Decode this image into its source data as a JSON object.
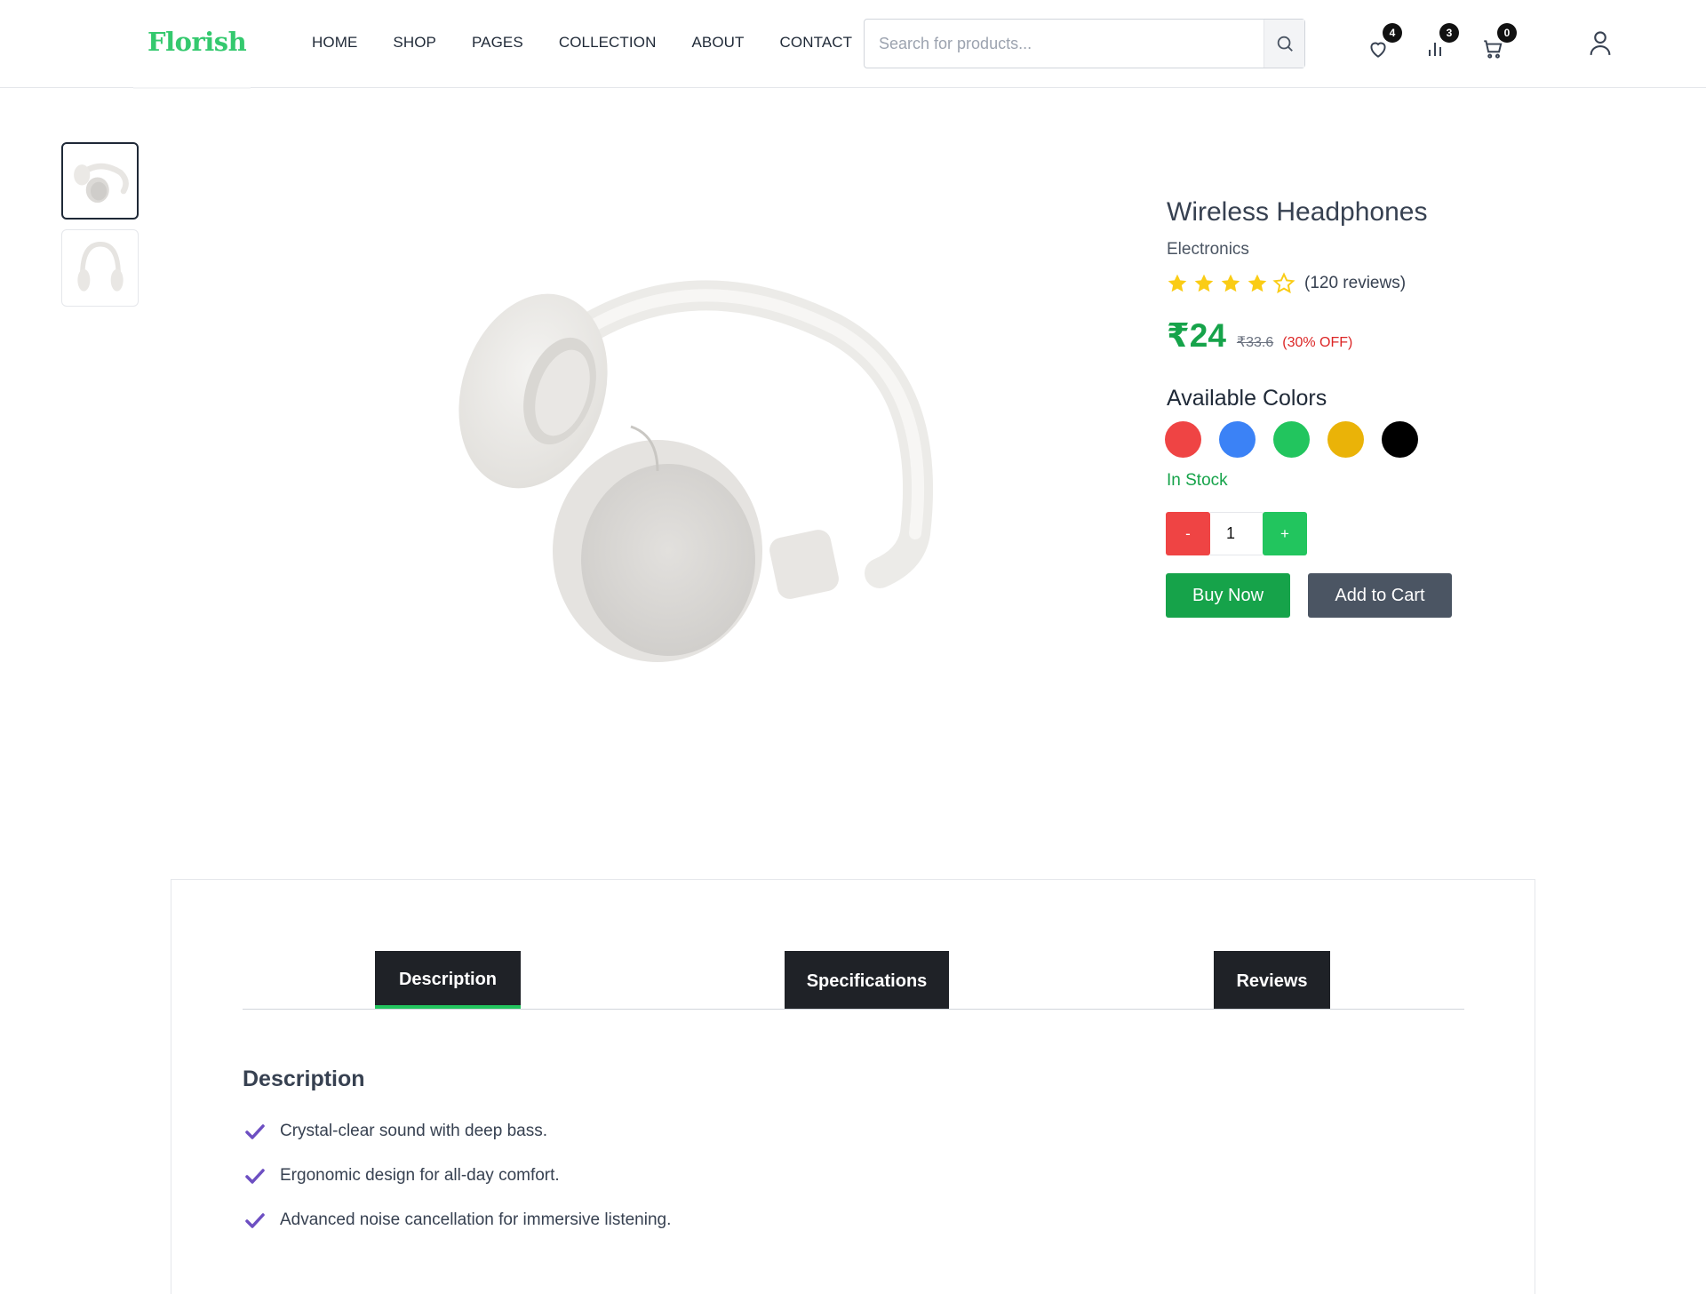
{
  "header": {
    "logo": "Florish",
    "nav": [
      "HOME",
      "SHOP",
      "PAGES",
      "COLLECTION",
      "ABOUT",
      "CONTACT"
    ],
    "search_placeholder": "Search for products...",
    "wishlist_count": "4",
    "compare_count": "3",
    "cart_count": "0"
  },
  "product": {
    "title": "Wireless Headphones",
    "category": "Electronics",
    "rating": 4,
    "rating_max": 5,
    "reviews": "(120 reviews)",
    "price": "₹24",
    "old_price": "₹33.6",
    "discount": "(30% OFF)",
    "colors_label": "Available Colors",
    "colors": [
      "#ef4444",
      "#3b82f6",
      "#22c55e",
      "#eab308",
      "#000000"
    ],
    "stock": "In Stock",
    "quantity": "1",
    "minus_label": "-",
    "plus_label": "+",
    "buy_now": "Buy Now",
    "add_to_cart": "Add to Cart"
  },
  "tabs": {
    "items": [
      "Description",
      "Specifications",
      "Reviews"
    ],
    "active": "Description"
  },
  "description": {
    "title": "Description",
    "points": [
      "Crystal-clear sound with deep bass.",
      "Ergonomic design for all-day comfort.",
      "Advanced noise cancellation for immersive listening."
    ]
  },
  "colors": {
    "brand": "#34c96e",
    "price": "#16a34a",
    "discount": "#dc2626",
    "tab_bg": "#1f2227",
    "check": "#6d4fc2"
  }
}
